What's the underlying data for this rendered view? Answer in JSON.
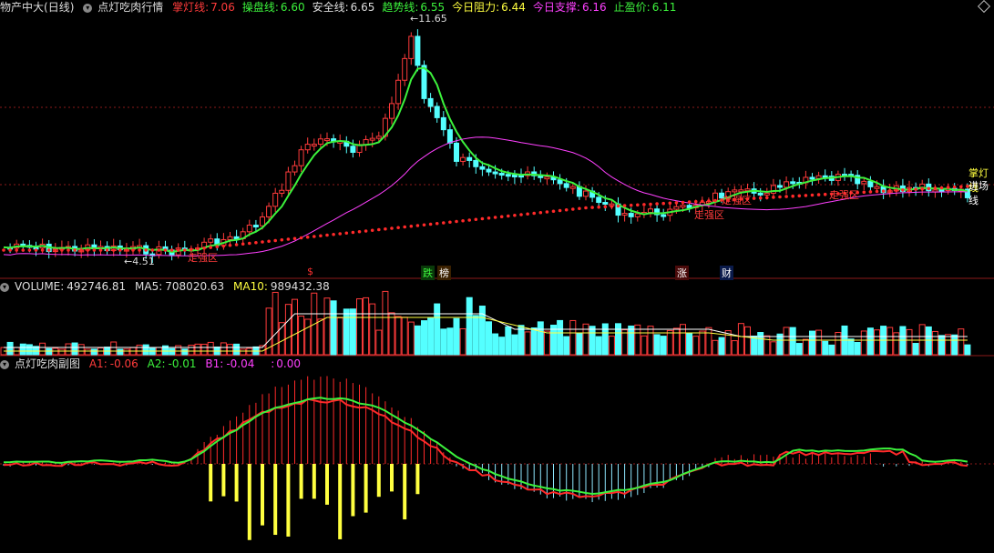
{
  "header": {
    "stock": "物产中大",
    "period": "(日线)",
    "indicator": "点灯吃肉行情",
    "items": [
      {
        "label": "掌灯线:",
        "value": "7.06",
        "color": "#ff3b3b"
      },
      {
        "label": "操盘线:",
        "value": "6.60",
        "color": "#3cf23c"
      },
      {
        "label": "安全线:",
        "value": "6.65",
        "color": "#dddddd"
      },
      {
        "label": "趋势线:",
        "value": "6.55",
        "color": "#3cf23c"
      },
      {
        "label": "今日阻力:",
        "value": "6.44",
        "color": "#ffff40"
      },
      {
        "label": "今日支撑:",
        "value": "6.16",
        "color": "#ff40ff"
      },
      {
        "label": "止盈价:",
        "value": "6.11",
        "color": "#3cf23c"
      }
    ]
  },
  "main_annotations": {
    "high_label": "11.65",
    "low_label": "4.51",
    "zone_label": "走强区",
    "zone_label2": "走强区",
    "zone_label3": "走强区",
    "zone_label4": "走强区",
    "right_label1": "掌灯线",
    "right_label2": "进场线",
    "tags": [
      {
        "text": "$",
        "color": "#ff3030"
      },
      {
        "text": "跌",
        "color": "#3cf23c"
      },
      {
        "text": "榜",
        "color": "#ffffff"
      },
      {
        "text": "涨",
        "color": "#ffffff"
      },
      {
        "text": "财",
        "color": "#ffffff"
      }
    ]
  },
  "volume_header": {
    "name": "VOLUME:",
    "value": "492746.81",
    "ma5_label": "MA5:",
    "ma5": "708020.63",
    "ma10_label": "MA10:",
    "ma10": "989432.38"
  },
  "sub_header": {
    "name": "点灯吃肉副图",
    "a1_label": "A1:",
    "a1": "-0.06",
    "a2_label": "A2:",
    "a2": "-0.01",
    "b1_label": "B1:",
    "b1": "-0.04",
    "extra_label": ":",
    "extra": "0.00"
  },
  "colors": {
    "up": "#ff3b3b",
    "down": "#54ffff",
    "green": "#3cf23c",
    "magenta": "#ff40ff",
    "yellow": "#ffff40",
    "red": "#ff2a2a"
  }
}
